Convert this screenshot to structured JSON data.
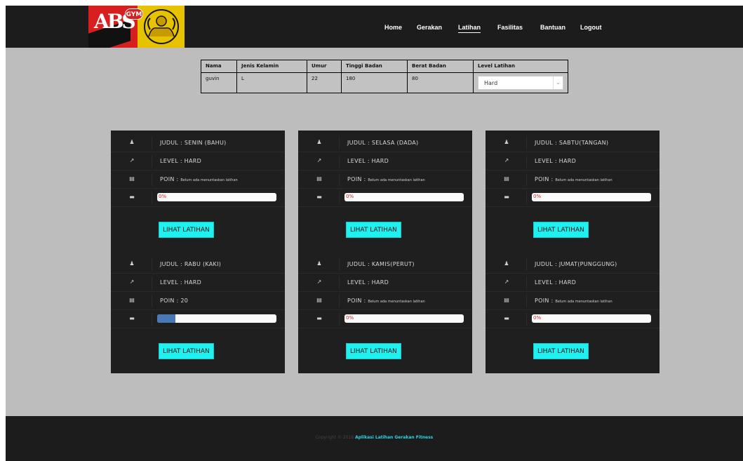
{
  "logo": {
    "letters": "ABS",
    "badge": "GYM"
  },
  "nav": {
    "items": [
      {
        "label": "Home"
      },
      {
        "label": "Gerakan"
      },
      {
        "label": "Latihan"
      },
      {
        "label": "Fasilitas"
      },
      {
        "label": "Bantuan"
      },
      {
        "label": "Logout"
      }
    ],
    "active": "Latihan"
  },
  "info_table": {
    "headers": [
      "Nama",
      "Jenis Kelamin",
      "Umur",
      "Tinggi Badan",
      "Berat Badan",
      "Level Latihan"
    ],
    "row": [
      "guvin",
      "L",
      "22",
      "180",
      "80"
    ],
    "level_selected": "Hard"
  },
  "cards": [
    {
      "judul": "JUDUL : SENIN (BAHU)",
      "level": "LEVEL : HARD",
      "poin_label": "POIN :",
      "poin_value": "Belum ada menuntaskan latihan",
      "progress_text": "0%",
      "progress_fraction": 0,
      "button": "LIHAT LATIHAN"
    },
    {
      "judul": "JUDUL : SELASA (DADA)",
      "level": "LEVEL : HARD",
      "poin_label": "POIN :",
      "poin_value": "Belum ada menuntaskan latihan",
      "progress_text": "0%",
      "progress_fraction": 0,
      "button": "LIHAT LATIHAN"
    },
    {
      "judul": "JUDUL : SABTU(TANGAN)",
      "level": "LEVEL : HARD",
      "poin_label": "POIN :",
      "poin_value": "Belum ada menuntaskan latihan",
      "progress_text": "0%",
      "progress_fraction": 0,
      "button": "LIHAT LATIHAN"
    },
    {
      "judul": "JUDUL : RABU (KAKI)",
      "level": "LEVEL : HARD",
      "poin_label": "POIN : 20",
      "poin_value": "",
      "progress_text": "",
      "progress_fraction": 0.15,
      "button": "LIHAT LATIHAN"
    },
    {
      "judul": "JUDUL : KAMIS(PERUT)",
      "level": "LEVEL : HARD",
      "poin_label": "POIN :",
      "poin_value": "Belum ada menuntaskan latihan",
      "progress_text": "0%",
      "progress_fraction": 0,
      "button": "LIHAT LATIHAN"
    },
    {
      "judul": "JUDUL : JUMAT(PUNGGUNG)",
      "level": "LEVEL : HARD",
      "poin_label": "POIN :",
      "poin_value": "Belum ada menuntaskan latihan",
      "progress_text": "0%",
      "progress_fraction": 0,
      "button": "LIHAT LATIHAN"
    }
  ],
  "footer": {
    "copyright": "Copyright © 2018",
    "app_name": "Aplikasi Latihan Gerakan Fitness"
  }
}
